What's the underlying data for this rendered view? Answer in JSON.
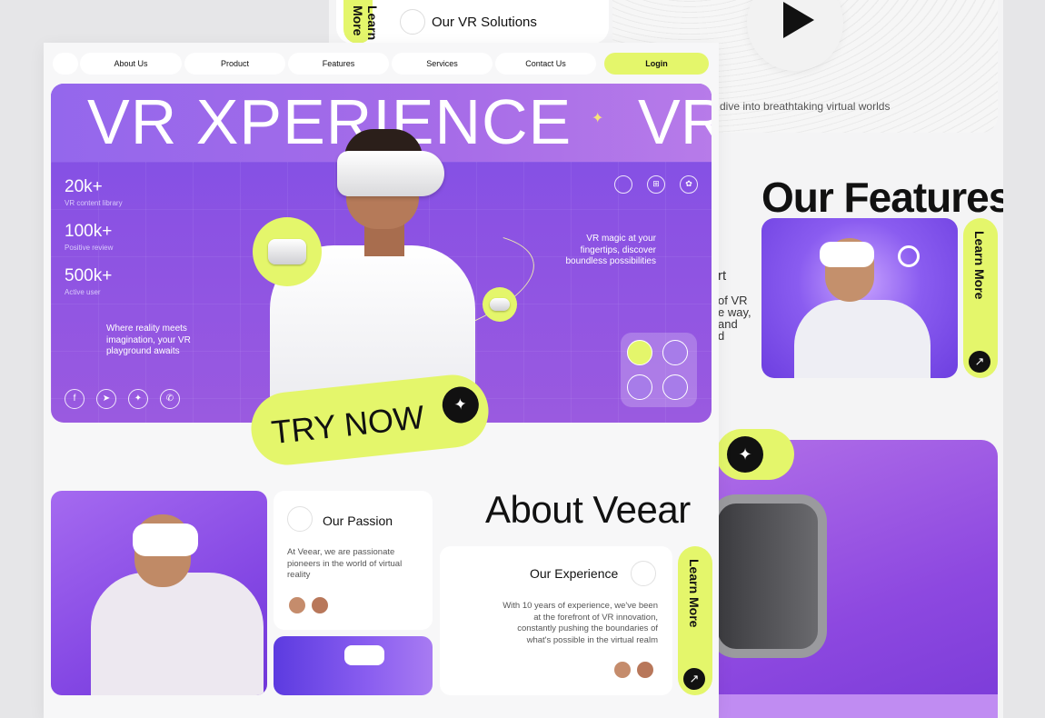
{
  "back": {
    "solutions_title": "Our VR Solutions",
    "learn_more_top": "Learn More",
    "wave_text": "e dive into breathtaking virtual worlds",
    "features_title": "Our Features",
    "features_learn_more": "Learn More",
    "cutoff_lines": [
      "rt",
      "of VR",
      "e way,",
      "and",
      "d"
    ]
  },
  "nav": {
    "items": [
      "About Us",
      "Product",
      "Features",
      "Services",
      "Contact Us"
    ],
    "login": "Login"
  },
  "hero": {
    "title": "VR XPERIENCE",
    "title_repeat": "VR",
    "stats": [
      {
        "num": "20k+",
        "label": "VR content library"
      },
      {
        "num": "100k+",
        "label": "Positive review"
      },
      {
        "num": "500k+",
        "label": "Active user"
      }
    ],
    "left_copy": "Where reality meets imagination, your VR playground awaits",
    "right_copy": "VR magic at your fingertips, discover boundless possibilities",
    "cta": "TRY NOW",
    "socials": [
      "facebook-icon",
      "telegram-icon",
      "twitter-icon",
      "whatsapp-icon"
    ],
    "platforms": [
      "apple-icon",
      "windows-icon",
      "huawei-icon"
    ]
  },
  "about": {
    "title": "About Veear",
    "passion": {
      "title": "Our Passion",
      "text": "At Veear, we are passionate pioneers in the world of virtual reality"
    },
    "experience": {
      "title": "Our Experience",
      "text": "With 10 years of experience, we've been at the forefront of VR innovation, constantly pushing the boundaries of what's possible in the virtual realm"
    },
    "learn_more": "Learn More"
  },
  "colors": {
    "accent": "#e4f66b",
    "purple": "#8b52e3",
    "dark": "#111111"
  }
}
